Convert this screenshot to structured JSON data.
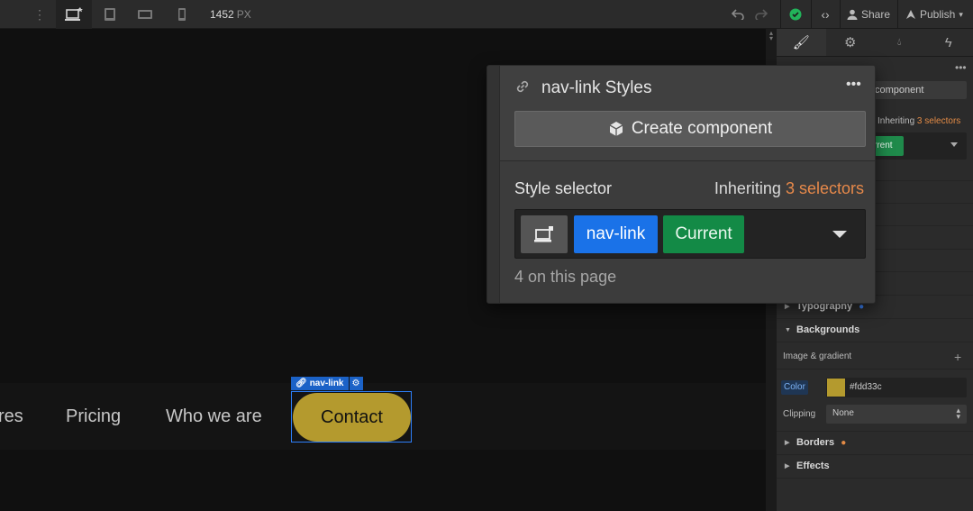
{
  "topbar": {
    "width_value": "1452",
    "width_unit": "PX",
    "share_label": "Share",
    "publish_label": "Publish",
    "icons": [
      "more-vertical-icon",
      "desktop-icon",
      "tablet-icon",
      "mobile-landscape-icon",
      "mobile-portrait-icon",
      "undo-icon",
      "redo-icon",
      "check-circle-icon",
      "code-icon",
      "user-icon",
      "publish-icon"
    ]
  },
  "canvas": {
    "nav_links": [
      "res",
      "Pricing",
      "Who we are"
    ],
    "contact_label": "Contact",
    "selection_tag": "nav-link"
  },
  "popup": {
    "title": "nav-link Styles",
    "create_component_label": "Create component",
    "style_selector_label": "Style selector",
    "inheriting_prefix": "Inheriting",
    "inheriting_count": "3 selectors",
    "selector_chips": [
      "nav-link",
      "Current"
    ],
    "page_count": "4 on this page"
  },
  "right_panel": {
    "selector_input_fragment": "component",
    "inheriting_prefix_fragment": "Inheriting",
    "inheriting_count": "3 selectors",
    "chip_fragment": "rrent",
    "sections": {
      "typography": "Typography",
      "backgrounds": "Backgrounds",
      "image_gradient": "Image & gradient",
      "color_label": "Color",
      "color_value": "#fdd33c",
      "clipping_label": "Clipping",
      "clipping_value": "None",
      "borders": "Borders",
      "effects": "Effects"
    }
  },
  "colors": {
    "accent_blue": "#1a72e8",
    "current_green": "#138a46",
    "inherit_orange": "#e7894a",
    "contact_fill": "#b49a2e"
  }
}
